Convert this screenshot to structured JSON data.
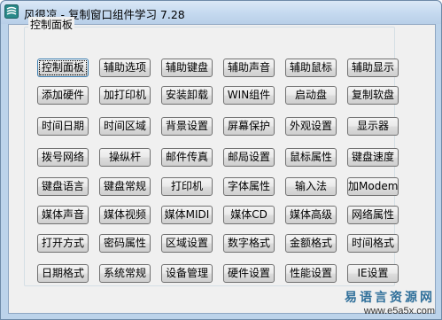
{
  "window": {
    "title": "风很凉 - 复制窗口组件学习 7.28"
  },
  "group": {
    "title": "控制面板"
  },
  "buttons": [
    [
      "控制面板",
      "辅助选项",
      "辅助键盘",
      "辅助声音",
      "辅助鼠标",
      "辅助显示"
    ],
    [
      "添加硬件",
      "加打印机",
      "安装卸载",
      "WIN组件",
      "启动盘",
      "复制软盘"
    ],
    [
      "时间日期",
      "时间区域",
      "背景设置",
      "屏幕保护",
      "外观设置",
      "显示器"
    ],
    [
      "拨号网络",
      "操纵杆",
      "邮件传真",
      "邮局设置",
      "鼠标属性",
      "键盘速度"
    ],
    [
      "键盘语言",
      "键盘常规",
      "打印机",
      "字体属性",
      "输入法",
      "加Modem"
    ],
    [
      "媒体声音",
      "媒体视频",
      "媒体MIDI",
      "媒体CD",
      "媒体高级",
      "网络属性"
    ],
    [
      "打开方式",
      "密码属性",
      "区域设置",
      "数字格式",
      "金额格式",
      "时间格式"
    ],
    [
      "日期格式",
      "系统常规",
      "设备管理",
      "硬件设置",
      "性能设置",
      "IE设置"
    ]
  ],
  "watermark": {
    "site_name": "易语言资源网",
    "url": "www.e5a5x.com"
  }
}
